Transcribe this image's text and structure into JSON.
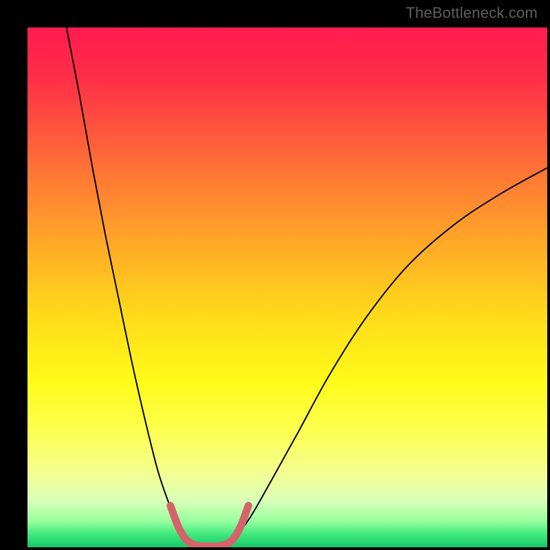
{
  "watermark": "TheBottleneck.com",
  "chart_data": {
    "type": "line",
    "title": "",
    "xlabel": "",
    "ylabel": "",
    "xlim": [
      0,
      100
    ],
    "ylim": [
      0,
      100
    ],
    "plot_bg_gradient": {
      "stops": [
        {
          "offset": 0,
          "color": "#ff1b50"
        },
        {
          "offset": 0.1,
          "color": "#ff2f47"
        },
        {
          "offset": 0.25,
          "color": "#ff6a38"
        },
        {
          "offset": 0.4,
          "color": "#ffa329"
        },
        {
          "offset": 0.55,
          "color": "#ffd91a"
        },
        {
          "offset": 0.68,
          "color": "#fffb18"
        },
        {
          "offset": 0.78,
          "color": "#fdff53"
        },
        {
          "offset": 0.86,
          "color": "#f3ff94"
        },
        {
          "offset": 0.91,
          "color": "#d9ffb8"
        },
        {
          "offset": 0.95,
          "color": "#97ff9e"
        },
        {
          "offset": 0.975,
          "color": "#3fe97e"
        },
        {
          "offset": 1.0,
          "color": "#17c766"
        }
      ]
    },
    "series": [
      {
        "name": "left-branch",
        "stroke": "#000000",
        "stroke_width": 2,
        "x": [
          7.5,
          10,
          12.5,
          15,
          17.5,
          20,
          22.5,
          25,
          27,
          29,
          30.5,
          32
        ],
        "y": [
          100,
          87,
          73,
          60,
          48,
          36,
          25,
          15,
          9,
          4,
          1.5,
          0.5
        ]
      },
      {
        "name": "right-branch",
        "stroke": "#000000",
        "stroke_width": 2,
        "x": [
          38,
          40,
          43,
          47,
          52,
          58,
          65,
          73,
          82,
          91,
          100
        ],
        "y": [
          0.5,
          2,
          6,
          13,
          22,
          33,
          44,
          54,
          62,
          68,
          73
        ]
      },
      {
        "name": "valley-highlight",
        "stroke": "#d6636b",
        "stroke_width": 11,
        "linecap": "round",
        "x": [
          27.5,
          29,
          30.5,
          32,
          33.5,
          35,
          36.5,
          38,
          39.5,
          41,
          42.5
        ],
        "y": [
          8,
          4,
          1.5,
          0.5,
          0.2,
          0.2,
          0.2,
          0.5,
          1.5,
          4,
          8
        ]
      }
    ]
  }
}
